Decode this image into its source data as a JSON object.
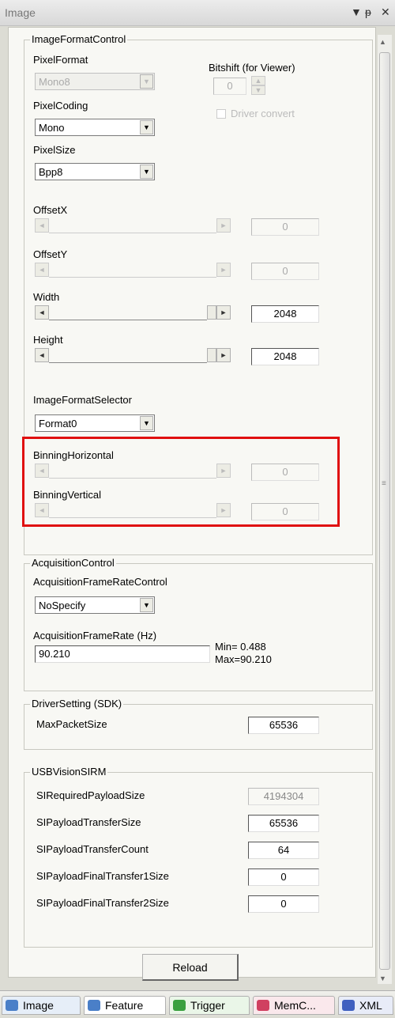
{
  "window": {
    "title": "Image",
    "icons": [
      "dropdown-arrow-icon",
      "pin-icon",
      "close-icon"
    ]
  },
  "image_format_control": {
    "legend": "ImageFormatControl",
    "pixel_format": {
      "label": "PixelFormat",
      "value": "Mono8"
    },
    "bitshift": {
      "label": "Bitshift (for Viewer)",
      "value": "0"
    },
    "driver_convert": {
      "label": "Driver convert",
      "checked": false
    },
    "pixel_coding": {
      "label": "PixelCoding",
      "value": "Mono"
    },
    "pixel_size": {
      "label": "PixelSize",
      "value": "Bpp8"
    },
    "offset_x": {
      "label": "OffsetX",
      "value": "0"
    },
    "offset_y": {
      "label": "OffsetY",
      "value": "0"
    },
    "width": {
      "label": "Width",
      "value": "2048"
    },
    "height": {
      "label": "Height",
      "value": "2048"
    },
    "image_format_selector": {
      "label": "ImageFormatSelector",
      "value": "Format0"
    },
    "binning_horizontal": {
      "label": "BinningHorizontal",
      "value": "0"
    },
    "binning_vertical": {
      "label": "BinningVertical",
      "value": "0"
    }
  },
  "acquisition_control": {
    "legend": "AcquisitionControl",
    "frame_rate_control": {
      "label": "AcquisitionFrameRateControl",
      "value": "NoSpecify"
    },
    "frame_rate": {
      "label": "AcquisitionFrameRate (Hz)",
      "value": "90.210"
    },
    "min": "Min= 0.488",
    "max": "Max=90.210"
  },
  "driver_setting": {
    "legend": "DriverSetting (SDK)",
    "max_packet_size": {
      "label": "MaxPacketSize",
      "value": "65536"
    }
  },
  "usb_vision_sirm": {
    "legend": "USBVisionSIRM",
    "rows": [
      {
        "label": "SIRequiredPayloadSize",
        "value": "4194304"
      },
      {
        "label": "SIPayloadTransferSize",
        "value": "65536"
      },
      {
        "label": "SIPayloadTransferCount",
        "value": "64"
      },
      {
        "label": "SIPayloadFinalTransfer1Size",
        "value": "0"
      },
      {
        "label": "SIPayloadFinalTransfer2Size",
        "value": "0"
      }
    ]
  },
  "reload_label": "Reload",
  "tabs": [
    {
      "label": "Image",
      "color": "#4a7fc8"
    },
    {
      "label": "Feature",
      "color": "#4a7fc8"
    },
    {
      "label": "Trigger",
      "color": "#3aa040"
    },
    {
      "label": "MemC...",
      "color": "#d04060"
    },
    {
      "label": "XML",
      "color": "#4060c0"
    }
  ]
}
